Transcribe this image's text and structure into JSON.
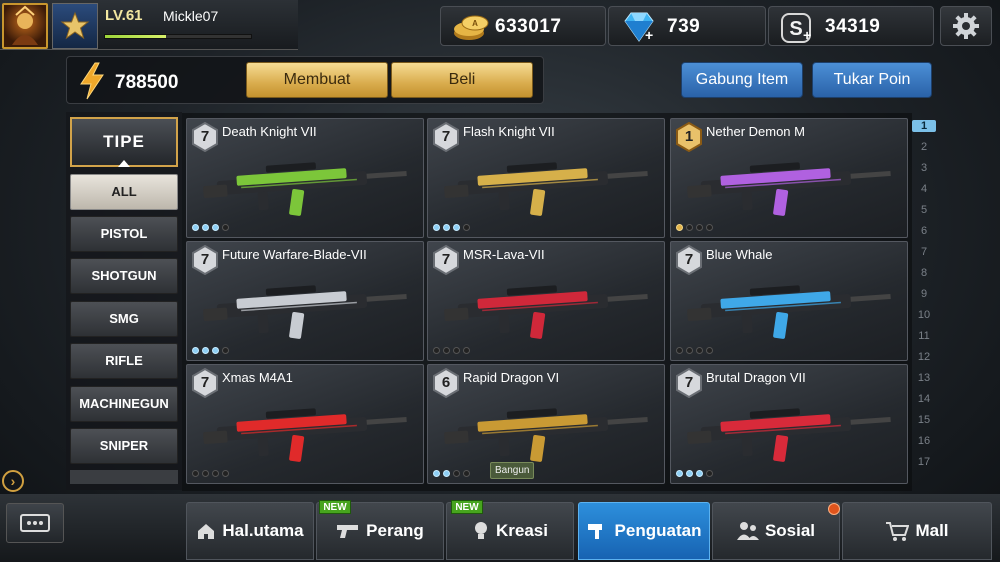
{
  "player": {
    "level": "LV.61",
    "name": "Mickle07",
    "xp_fraction": 0.42
  },
  "resources": {
    "gold": "633017",
    "gems": "739",
    "points": "34319"
  },
  "energy": {
    "value": "788500"
  },
  "actions": {
    "membuat": "Membuat",
    "beli": "Beli",
    "gabung": "Gabung Item",
    "tukar": "Tukar Poin"
  },
  "categories": {
    "header": "TIPE",
    "items": [
      "ALL",
      "PISTOL",
      "SHOTGUN",
      "SMG",
      "RIFLE",
      "MACHINEGUN",
      "SNIPER"
    ],
    "active": "ALL"
  },
  "weapons": [
    {
      "name": "Death Knight VII",
      "stars": "7",
      "pips": 3,
      "tier": "silver",
      "color": "#7cc63a"
    },
    {
      "name": "Flash Knight VII",
      "stars": "7",
      "pips": 3,
      "tier": "silver",
      "color": "#d6b04a"
    },
    {
      "name": "Nether Demon M",
      "stars": "1",
      "pips": 1,
      "tier": "gold",
      "color": "#b061e0"
    },
    {
      "name": "Future Warfare-Blade-VII",
      "stars": "7",
      "pips": 3,
      "tier": "silver",
      "color": "#c8ccd2"
    },
    {
      "name": "MSR-Lava-VII",
      "stars": "7",
      "pips": 0,
      "tier": "silver",
      "color": "#d0283a"
    },
    {
      "name": "Blue Whale",
      "stars": "7",
      "pips": 0,
      "tier": "silver",
      "color": "#3fa8e8"
    },
    {
      "name": "Xmas M4A1",
      "stars": "7",
      "pips": 0,
      "tier": "silver",
      "color": "#e02a2a"
    },
    {
      "name": "Rapid Dragon VI",
      "stars": "6",
      "pips": 2,
      "tier": "silver",
      "color": "#c99a34",
      "tag": "Bangun"
    },
    {
      "name": "Brutal Dragon VII",
      "stars": "7",
      "pips": 3,
      "tier": "silver",
      "color": "#d82a3a"
    }
  ],
  "page_index": {
    "pages": [
      "1",
      "2",
      "3",
      "4",
      "5",
      "6",
      "7",
      "8",
      "9",
      "10",
      "11",
      "12",
      "13",
      "14",
      "15",
      "16",
      "17"
    ],
    "active": "1"
  },
  "nav": {
    "tabs": [
      "Hal.utama",
      "Perang",
      "Kreasi",
      "Penguatan",
      "Sosial",
      "Mall"
    ],
    "active": "Penguatan",
    "new_badge": "NEW"
  },
  "colors": {
    "accent_gold": "#d9ac4d",
    "accent_blue": "#2d8fdc",
    "new_green": "#47a41e"
  }
}
